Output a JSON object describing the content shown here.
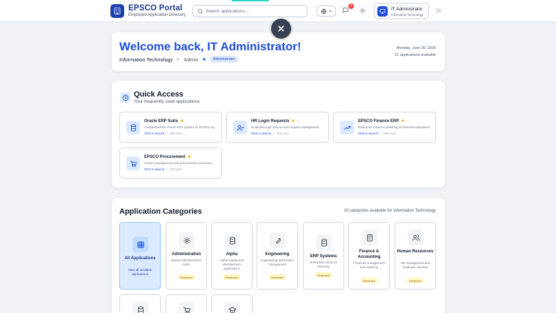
{
  "header": {
    "brand_title": "EPSCO Portal",
    "brand_subtitle": "Employee Application Directory",
    "search_placeholder": "Search applications...",
    "notification_count": "2",
    "user_name": "IT Administrator",
    "user_dept": "Information Technology"
  },
  "welcome": {
    "title": "Welcome back, IT Administrator!",
    "department": "Information Technology",
    "role": "Admin",
    "role_badge": "Administrator",
    "date": "Monday, June 30, 2025",
    "apps_available": "21 applications available"
  },
  "quick_access": {
    "title": "Quick Access",
    "subtitle": "Your frequently used applications",
    "launch_label": "Click to launch",
    "apps": [
      {
        "name": "Oracle ERP Suite",
        "desc": "Comprehensive Oracle ERP system for EPSCO operations",
        "uses": "188 uses",
        "icon": "database-icon"
      },
      {
        "name": "HR Login Requests",
        "desc": "Employee login and access request management",
        "uses": "323 uses",
        "icon": "user-check-icon"
      },
      {
        "name": "EPSCO Finance ERP",
        "desc": "Enterprise resource planning for financial operations",
        "uses": "196 uses",
        "icon": "trending-up-icon"
      },
      {
        "name": "EPSCO Procurement",
        "desc": "Vendor management and procurement processes",
        "uses": "229 uses",
        "icon": "cart-icon"
      }
    ]
  },
  "categories": {
    "title": "Application Categories",
    "subtitle": "10 categories available for Information Technology",
    "items": [
      {
        "name": "All Applications",
        "desc": "View all available applications",
        "badge": "",
        "icon": "grid-icon"
      },
      {
        "name": "Administration",
        "desc": "System administration tools",
        "badge": "Restricted",
        "icon": "gear-icon"
      },
      {
        "name": "Alpha",
        "desc": "Alpha testing and development applications",
        "badge": "Restricted",
        "icon": "database-icon"
      },
      {
        "name": "Engineering",
        "desc": "Engineering and project management",
        "badge": "Restricted",
        "icon": "wrench-icon"
      },
      {
        "name": "ERP Systems",
        "desc": "Enterprise resource planning",
        "badge": "Restricted",
        "icon": "database-icon"
      },
      {
        "name": "Finance & Accounting",
        "desc": "Financial management and reporting",
        "badge": "Restricted",
        "icon": "calculator-icon"
      },
      {
        "name": "Human Resources",
        "desc": "HR management and employee services",
        "badge": "Restricted",
        "icon": "users-icon"
      }
    ],
    "row2_icons": [
      "database-icon",
      "cart-icon",
      "graduation-cap-icon"
    ]
  },
  "colors": {
    "brand": "#1e40af",
    "heading_blue": "#1d4ed8",
    "restricted_bg": "#fef9c3",
    "notification_red": "#ef4444"
  }
}
